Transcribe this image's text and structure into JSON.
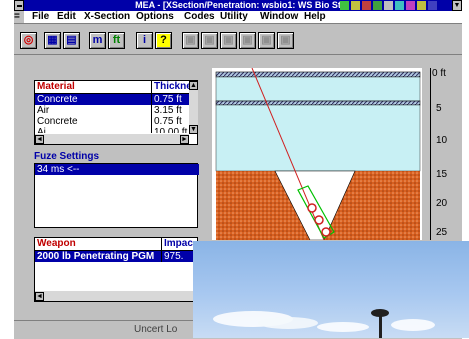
{
  "window": {
    "title": "MEA - [XSection/Penetration: wsbio1: WS Bio St"
  },
  "menu": [
    "File",
    "Edit",
    "X-Section",
    "Options",
    "Codes",
    "Utility",
    "Window",
    "Help"
  ],
  "toolbar": {
    "m_label": "m",
    "ft_label": "ft",
    "info_label": "i",
    "help_label": "?"
  },
  "material_table": {
    "headers": [
      "Material",
      "Thickne"
    ],
    "rows": [
      [
        "Concrete",
        "0.75 ft"
      ],
      [
        "Air",
        "3.15 ft"
      ],
      [
        "Concrete",
        "0.75 ft"
      ],
      [
        "Ai",
        "10.00 ft"
      ]
    ],
    "selected_row": 0
  },
  "fuze": {
    "title": "Fuze Settings",
    "items": [
      "34 ms <--"
    ]
  },
  "weapon_table": {
    "headers": [
      "Weapon",
      "Impac"
    ],
    "rows": [
      [
        "2000 lb Penetrating PGM",
        "975."
      ]
    ]
  },
  "depth_axis": {
    "ticks": [
      "0 ft",
      "5",
      "10",
      "15",
      "20",
      "25"
    ]
  },
  "status": {
    "text": "Uncert Lo"
  },
  "colors": {
    "title_bar": "#0000a8",
    "header_text": "#c00000",
    "sky": "#c8f0f4",
    "earth": "#d86020"
  }
}
